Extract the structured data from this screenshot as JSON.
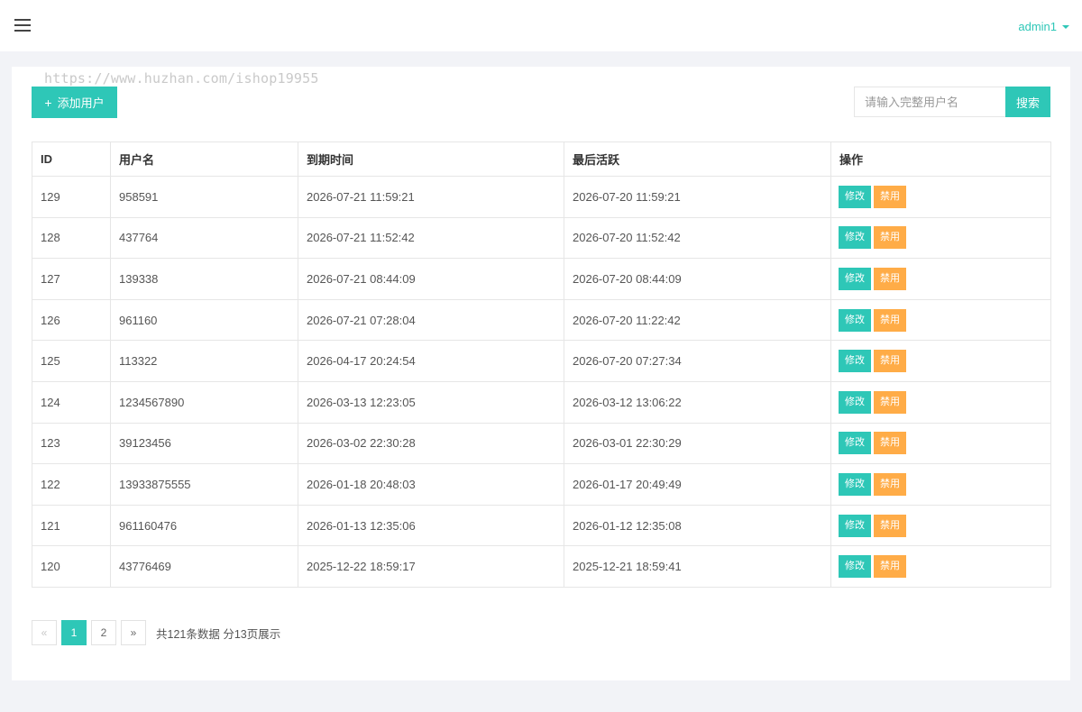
{
  "topbar": {
    "menu_icon": "hamburger-menu-icon",
    "username": "admin1",
    "user_caret_icon": "caret-down-icon"
  },
  "watermark": "https://www.huzhan.com/ishop19955",
  "toolbar": {
    "add_icon": "+",
    "add_label": "添加用户",
    "search_placeholder": "请输入完整用户名",
    "search_value": "",
    "search_label": "搜索"
  },
  "table": {
    "headers": [
      "ID",
      "用户名",
      "到期时间",
      "最后活跃",
      "操作"
    ],
    "rows": [
      {
        "id": "129",
        "username": "958591",
        "expire": "2026-07-21 11:59:21",
        "last_active": "2026-07-20 11:59:21"
      },
      {
        "id": "128",
        "username": "437764",
        "expire": "2026-07-21 11:52:42",
        "last_active": "2026-07-20 11:52:42"
      },
      {
        "id": "127",
        "username": "139338",
        "expire": "2026-07-21 08:44:09",
        "last_active": "2026-07-20 08:44:09"
      },
      {
        "id": "126",
        "username": "961160",
        "expire": "2026-07-21 07:28:04",
        "last_active": "2026-07-20 11:22:42"
      },
      {
        "id": "125",
        "username": "113322",
        "expire": "2026-04-17 20:24:54",
        "last_active": "2026-07-20 07:27:34"
      },
      {
        "id": "124",
        "username": "1234567890",
        "expire": "2026-03-13 12:23:05",
        "last_active": "2026-03-12 13:06:22"
      },
      {
        "id": "123",
        "username": "39123456",
        "expire": "2026-03-02 22:30:28",
        "last_active": "2026-03-01 22:30:29"
      },
      {
        "id": "122",
        "username": "13933875555",
        "expire": "2026-01-18 20:48:03",
        "last_active": "2026-01-17 20:49:49"
      },
      {
        "id": "121",
        "username": "961160476",
        "expire": "2026-01-13 12:35:06",
        "last_active": "2026-01-12 12:35:08"
      },
      {
        "id": "120",
        "username": "43776469",
        "expire": "2025-12-22 18:59:17",
        "last_active": "2025-12-21 18:59:41"
      }
    ],
    "edit_label": "修改",
    "ban_label": "禁用"
  },
  "pagination": {
    "prev": "«",
    "pages": [
      "1",
      "2"
    ],
    "current": "1",
    "next": "»",
    "info": "共121条数据 分13页展示"
  },
  "colors": {
    "accent": "#2ec7b7",
    "warning": "#ffac47",
    "background": "#f2f3f7"
  }
}
